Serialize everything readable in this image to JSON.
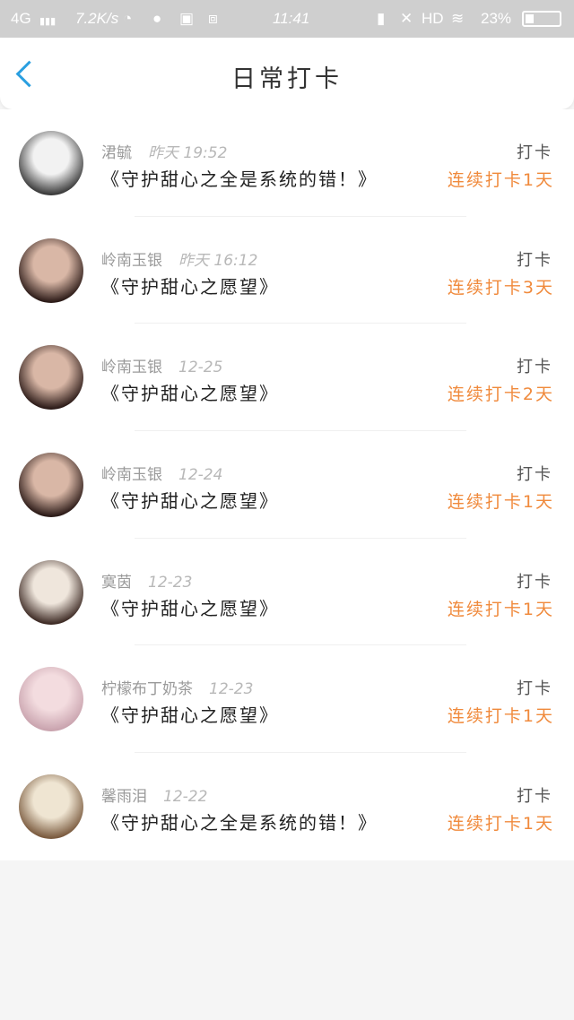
{
  "status_bar": {
    "network": "4G",
    "signal": "▮▮▮",
    "speed": "7.2K/s",
    "time": "11:41",
    "hd": "HD",
    "battery_pct": "23%"
  },
  "header": {
    "title": "日常打卡"
  },
  "entries": [
    {
      "name": "涒毓",
      "time": "昨天 19:52",
      "book": "《守护甜心之全是系统的错！》",
      "label": "打卡",
      "streak": "连续打卡1天",
      "avatar_colors": [
        "#f2f2f2",
        "#3a3a3a"
      ]
    },
    {
      "name": "岭南玉银",
      "time": "昨天 16:12",
      "book": "《守护甜心之愿望》",
      "label": "打卡",
      "streak": "连续打卡3天",
      "avatar_colors": [
        "#d9b7a6",
        "#2b1a17"
      ]
    },
    {
      "name": "岭南玉银",
      "time": "12-25",
      "book": "《守护甜心之愿望》",
      "label": "打卡",
      "streak": "连续打卡2天",
      "avatar_colors": [
        "#d9b7a6",
        "#2b1a17"
      ]
    },
    {
      "name": "岭南玉银",
      "time": "12-24",
      "book": "《守护甜心之愿望》",
      "label": "打卡",
      "streak": "连续打卡1天",
      "avatar_colors": [
        "#d9b7a6",
        "#2b1a17"
      ]
    },
    {
      "name": "寞茵",
      "time": "12-23",
      "book": "《守护甜心之愿望》",
      "label": "打卡",
      "streak": "连续打卡1天",
      "avatar_colors": [
        "#efe6dc",
        "#3d2a24"
      ]
    },
    {
      "name": "柠檬布丁奶茶",
      "time": "12-23",
      "book": "《守护甜心之愿望》",
      "label": "打卡",
      "streak": "连续打卡1天",
      "avatar_colors": [
        "#f3dcdf",
        "#c9a3ae"
      ]
    },
    {
      "name": "馨雨泪",
      "time": "12-22",
      "book": "《守护甜心之全是系统的错！》",
      "label": "打卡",
      "streak": "连续打卡1天",
      "avatar_colors": [
        "#efe5d2",
        "#7a5a3e"
      ]
    }
  ]
}
